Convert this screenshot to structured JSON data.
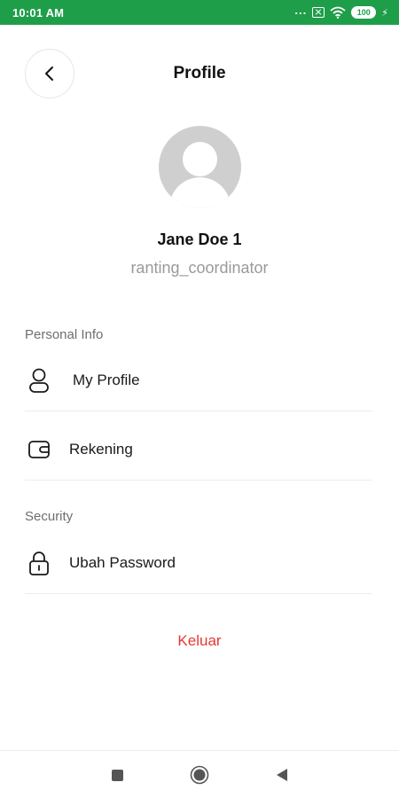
{
  "status_bar": {
    "time": "10:01 AM",
    "dots": "...",
    "battery": "100",
    "icons": [
      "sim-off-icon",
      "wifi-icon",
      "battery-icon",
      "charging-bolt-icon"
    ]
  },
  "header": {
    "title": "Profile",
    "back_icon": "chevron-left-icon"
  },
  "user": {
    "name": "Jane Doe 1",
    "role": "ranting_coordinator",
    "avatar_icon": "avatar-placeholder-icon"
  },
  "sections": {
    "personal_info": {
      "label": "Personal Info",
      "items": [
        {
          "label": "My Profile",
          "icon": "user-icon"
        },
        {
          "label": "Rekening",
          "icon": "wallet-icon"
        }
      ]
    },
    "security": {
      "label": "Security",
      "items": [
        {
          "label": "Ubah Password",
          "icon": "lock-icon"
        }
      ]
    }
  },
  "logout": {
    "label": "Keluar",
    "color": "#e53935"
  },
  "colors": {
    "status_bar": "#1f9e4a",
    "accent_red": "#e53935",
    "muted_text": "#9a9a9a"
  },
  "nav_bar": {
    "icons": [
      "recents-square-icon",
      "home-circle-icon",
      "back-triangle-icon"
    ]
  }
}
